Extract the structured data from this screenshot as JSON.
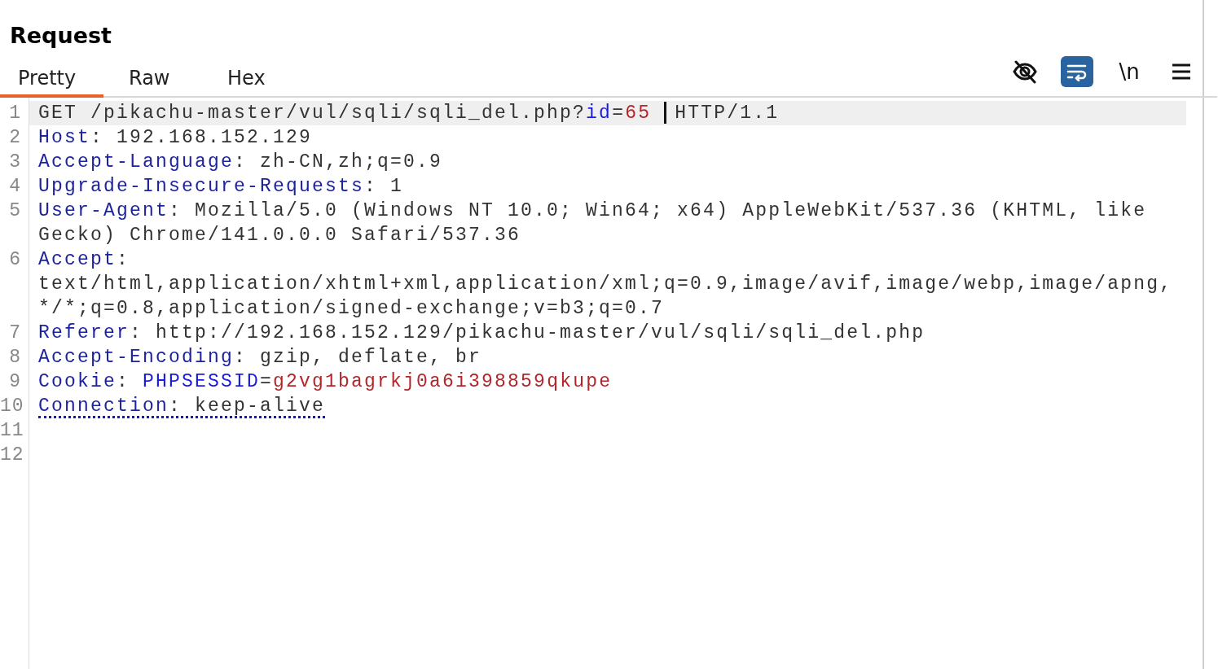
{
  "title": "Request",
  "tabs": [
    {
      "label": "Pretty",
      "selected": true
    },
    {
      "label": "Raw",
      "selected": false
    },
    {
      "label": "Hex",
      "selected": false
    }
  ],
  "toolbar": [
    {
      "kind": "hide",
      "on": false
    },
    {
      "kind": "wrap",
      "on": true
    },
    {
      "kind": "newline",
      "label": "\\n",
      "on": false
    },
    {
      "kind": "menu",
      "on": false
    }
  ],
  "lines": [
    {
      "number": "1",
      "current": true,
      "rows": [
        [
          {
            "kind": "plain",
            "text": "GET /pikachu-master/vul/sqli/sqli_del.php?"
          },
          {
            "kind": "param",
            "text": "id"
          },
          {
            "kind": "plain",
            "text": "="
          },
          {
            "kind": "value",
            "text": "65"
          },
          {
            "kind": "caret"
          },
          {
            "kind": "plain",
            "text": "HTTP/1.1"
          }
        ]
      ]
    },
    {
      "number": "2",
      "current": false,
      "rows": [
        [
          {
            "kind": "name",
            "text": "Host"
          },
          {
            "kind": "plain",
            "text": ": 192.168.152.129"
          }
        ]
      ]
    },
    {
      "number": "3",
      "current": false,
      "rows": [
        [
          {
            "kind": "name",
            "text": "Accept-Language"
          },
          {
            "kind": "plain",
            "text": ": zh-CN,zh;q=0.9"
          }
        ]
      ]
    },
    {
      "number": "4",
      "current": false,
      "rows": [
        [
          {
            "kind": "name",
            "text": "Upgrade-Insecure-Requests"
          },
          {
            "kind": "plain",
            "text": ": 1"
          }
        ]
      ]
    },
    {
      "number": "5",
      "current": false,
      "rows": [
        [
          {
            "kind": "name",
            "text": "User-Agent"
          },
          {
            "kind": "plain",
            "text": ": Mozilla/5.0 (Windows NT 10.0; Win64; x64) AppleWebKit/537.36 (KHTML, like"
          }
        ],
        [
          {
            "kind": "plain",
            "text": "Gecko) Chrome/141.0.0.0 Safari/537.36"
          }
        ]
      ]
    },
    {
      "number": "6",
      "current": false,
      "rows": [
        [
          {
            "kind": "name",
            "text": "Accept"
          },
          {
            "kind": "plain",
            "text": ":"
          }
        ],
        [
          {
            "kind": "plain",
            "text": "text/html,application/xhtml+xml,application/xml;q=0.9,image/avif,image/webp,image/apng,"
          }
        ],
        [
          {
            "kind": "plain",
            "text": "*/*;q=0.8,application/signed-exchange;v=b3;q=0.7"
          }
        ]
      ]
    },
    {
      "number": "7",
      "current": false,
      "rows": [
        [
          {
            "kind": "name",
            "text": "Referer"
          },
          {
            "kind": "plain",
            "text": ": http://192.168.152.129/pikachu-master/vul/sqli/sqli_del.php"
          }
        ]
      ]
    },
    {
      "number": "8",
      "current": false,
      "rows": [
        [
          {
            "kind": "name",
            "text": "Accept-Encoding"
          },
          {
            "kind": "plain",
            "text": ": gzip, deflate, br"
          }
        ]
      ]
    },
    {
      "number": "9",
      "current": false,
      "rows": [
        [
          {
            "kind": "name",
            "text": "Cookie"
          },
          {
            "kind": "plain",
            "text": ": "
          },
          {
            "kind": "param",
            "text": "PHPSESSID"
          },
          {
            "kind": "plain",
            "text": "="
          },
          {
            "kind": "value",
            "text": "g2vg1bagrkj0a6i398859qkupe"
          }
        ]
      ]
    },
    {
      "number": "10",
      "current": false,
      "underlined": true,
      "rows": [
        [
          {
            "kind": "name",
            "text": "Connection"
          },
          {
            "kind": "plain",
            "text": ": keep-alive"
          }
        ]
      ]
    },
    {
      "number": "11",
      "current": false,
      "rows": [
        []
      ]
    },
    {
      "number": "12",
      "current": false,
      "rows": [
        []
      ]
    }
  ]
}
